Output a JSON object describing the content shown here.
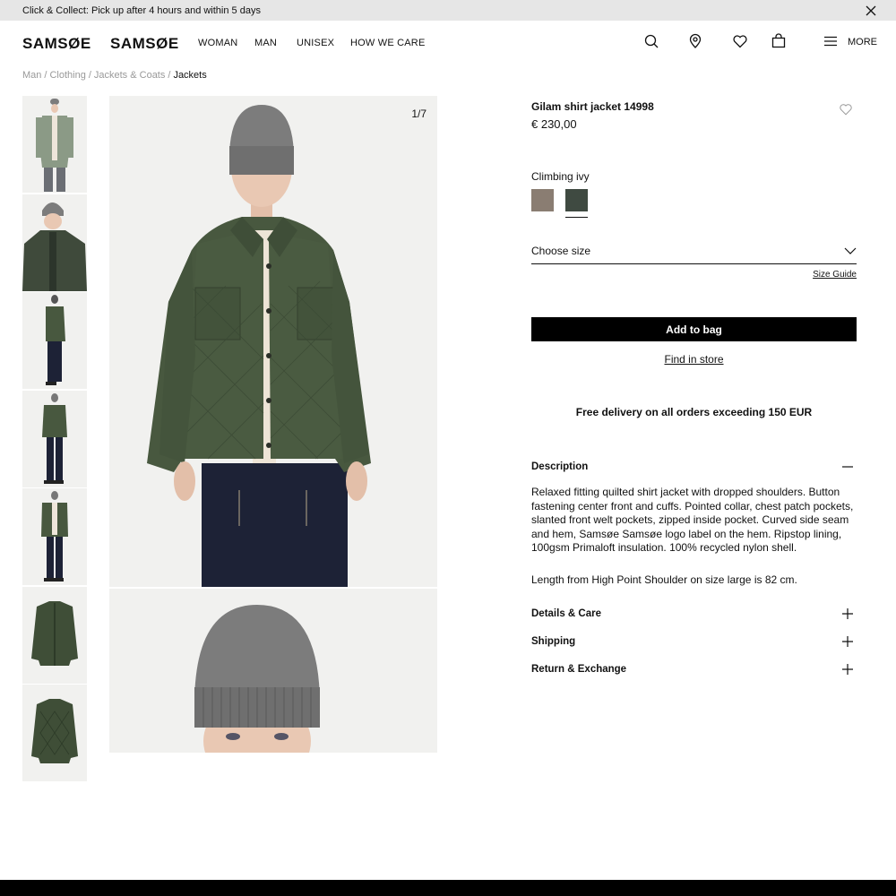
{
  "announcement": {
    "text": "Click & Collect: Pick up after 4 hours and within 5 days",
    "close_icon": "close-icon"
  },
  "header": {
    "logo_primary": "SAMSØE",
    "logo_secondary": "SAMSØE",
    "nav": [
      "WOMAN",
      "MAN",
      "UNISEX",
      "HOW WE CARE"
    ],
    "icons": [
      "search-icon",
      "location-pin-icon",
      "heart-icon",
      "bag-icon",
      "menu-icon"
    ],
    "more_label": "MORE"
  },
  "breadcrumb": {
    "items": [
      "Man",
      "Clothing",
      "Jackets & Coats"
    ],
    "current": "Jackets",
    "separator": "/"
  },
  "gallery": {
    "counter": "1/7",
    "thumbnail_count": 7
  },
  "product": {
    "title": "Gilam shirt jacket 14998",
    "price": "€ 230,00",
    "color_name": "Climbing ivy",
    "swatches": [
      {
        "color": "#8a7d72",
        "selected": false
      },
      {
        "color": "#3f4a41",
        "selected": true
      }
    ],
    "size_placeholder": "Choose size",
    "size_guide": "Size Guide",
    "add_to_bag": "Add to bag",
    "find_in_store": "Find in store",
    "free_delivery": "Free delivery on all orders exceeding 150 EUR"
  },
  "accordion": {
    "description": {
      "title": "Description",
      "text": "Relaxed fitting quilted shirt jacket with dropped shoulders. Button fastening center front and cuffs. Pointed collar, chest patch pockets, slanted front welt pockets, zipped inside pocket. Curved side seam and hem, Samsøe Samsøe logo label on the hem. Ripstop lining, 100gsm Primaloft insulation. 100% recycled nylon shell.",
      "length_note": "Length from High Point Shoulder on size large is 82 cm."
    },
    "details": "Details & Care",
    "shipping": "Shipping",
    "returns": "Return & Exchange"
  },
  "colors": {
    "jacket": "#48583f",
    "jeans": "#1d2236",
    "beanie": "#7c7c7c",
    "bg": "#f1f1ef",
    "skin": "#e9c8b3"
  }
}
